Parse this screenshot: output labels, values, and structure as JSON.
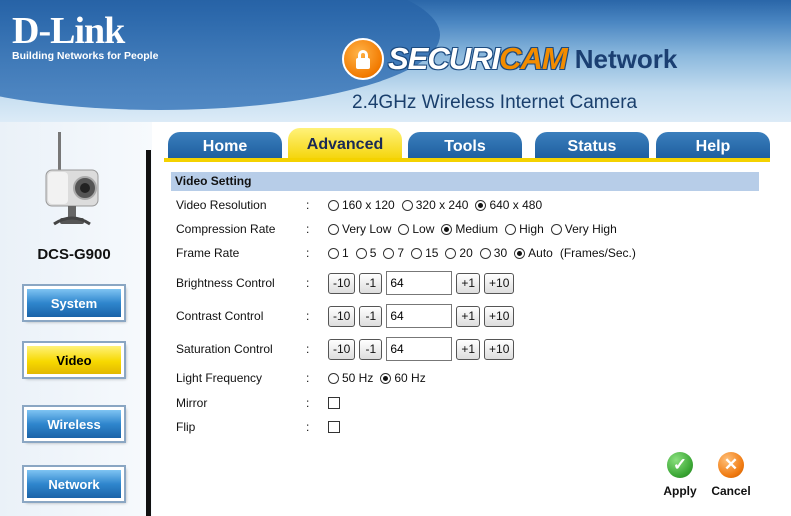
{
  "header": {
    "logo_name": "D-Link",
    "logo_tagline": "Building Networks for People",
    "brand_a": "SECURI",
    "brand_b": "CAM",
    "brand_c": "Network",
    "subtitle": "2.4GHz Wireless Internet Camera"
  },
  "sidebar": {
    "model": "DCS-G900",
    "items": [
      {
        "label": "System"
      },
      {
        "label": "Video"
      },
      {
        "label": "Wireless"
      },
      {
        "label": "Network"
      }
    ]
  },
  "tabs": [
    {
      "label": "Home"
    },
    {
      "label": "Advanced"
    },
    {
      "label": "Tools"
    },
    {
      "label": "Status"
    },
    {
      "label": "Help"
    }
  ],
  "section": {
    "title": "Video Setting"
  },
  "fields": {
    "resolution": {
      "label": "Video Resolution",
      "options": [
        "160 x 120",
        "320 x 240",
        "640 x 480"
      ],
      "selected": "640 x 480"
    },
    "compression": {
      "label": "Compression Rate",
      "options": [
        "Very Low",
        "Low",
        "Medium",
        "High",
        "Very High"
      ],
      "selected": "Medium"
    },
    "framerate": {
      "label": "Frame Rate",
      "options": [
        "1",
        "5",
        "7",
        "15",
        "20",
        "30",
        "Auto"
      ],
      "selected": "Auto",
      "unit": "(Frames/Sec.)"
    },
    "brightness": {
      "label": "Brightness Control",
      "value": "64"
    },
    "contrast": {
      "label": "Contrast Control",
      "value": "64"
    },
    "saturation": {
      "label": "Saturation Control",
      "value": "64"
    },
    "lightfreq": {
      "label": "Light Frequency",
      "options": [
        "50 Hz",
        "60 Hz"
      ],
      "selected": "60 Hz"
    },
    "mirror": {
      "label": "Mirror"
    },
    "flip": {
      "label": "Flip"
    }
  },
  "stepper": {
    "minus10": "-10",
    "minus1": "-1",
    "plus1": "+1",
    "plus10": "+10"
  },
  "colon": ":",
  "actions": {
    "apply": "Apply",
    "cancel": "Cancel"
  },
  "colors": {
    "tab_blue": "#1a5a9b",
    "active_yellow": "#f4d200",
    "section_bg": "#b7cde8",
    "apply_green": "#3aa634",
    "cancel_orange": "#f07a10"
  }
}
